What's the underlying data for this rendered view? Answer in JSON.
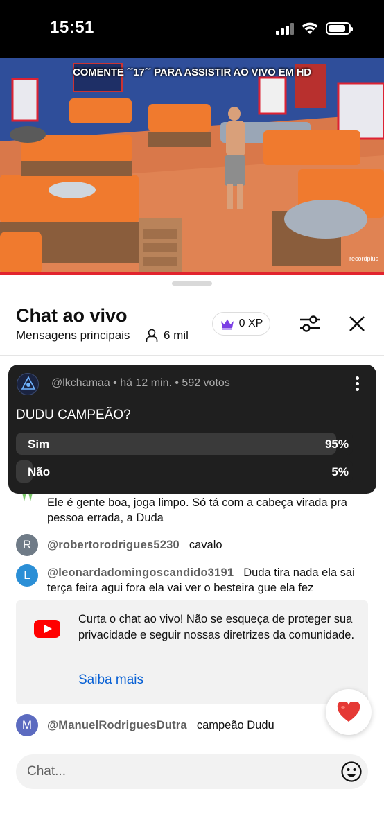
{
  "status_bar": {
    "time": "15:51"
  },
  "video": {
    "banner_text": "COMENTE ´´17´´ PARA ASSISTIR AO VIVO EM HD",
    "watermark": "recordplus",
    "progress": 1.0
  },
  "chat_header": {
    "title": "Chat ao vivo",
    "mode": "Mensagens principais",
    "viewers": "6 mil",
    "xp": "0 XP"
  },
  "poll": {
    "author": "@lkchamaa",
    "time": "há 12 min.",
    "votes": "592 votos",
    "meta": "@lkchamaa • há 12 min. • 592 votos",
    "question": "DUDU CAMPEÃO?",
    "options": [
      {
        "label": "Sim",
        "percent_text": "95%",
        "percent": 95
      },
      {
        "label": "Não",
        "percent_text": "5%",
        "percent": 5
      }
    ]
  },
  "messages": [
    {
      "author": "",
      "avatar_letter": "",
      "text": "Ele é gente boa, joga limpo. Só tá com a cabeça virada pra pessoa errada, a Duda",
      "avatar_color": "#7cc86a"
    },
    {
      "author": "@robertorodrigues5230",
      "avatar_letter": "R",
      "text": "cavalo",
      "avatar_color": "#6f7b87"
    },
    {
      "author": "@leonardadomingoscandido3191",
      "avatar_letter": "L",
      "text": "Duda tira nada ela sai terça feira agui fora ela vai ver o besteira gue ela fez",
      "avatar_color": "#2b8fd6"
    },
    {
      "author": "@ManuelRodriguesDutra",
      "avatar_letter": "M",
      "text": "campeão Dudu",
      "avatar_color": "#5c6bc0"
    }
  ],
  "info_card": {
    "text": "Curta o chat ao vivo! Não se esqueça de proteger sua privacidade e seguir nossas diretrizes da comunidade.",
    "link": "Saiba mais"
  },
  "chat_input": {
    "placeholder": "Chat..."
  },
  "colors": {
    "accent_red": "#ff0000",
    "link_blue": "#065fd4",
    "poll_bg": "#1f1f1f",
    "xp_crown": "#7b3fe4"
  },
  "icons": [
    "signal-icon",
    "wifi-icon",
    "battery-icon",
    "crown-icon",
    "person-icon",
    "filter-icon",
    "close-icon",
    "kebab-icon",
    "youtube-icon",
    "heart-icon",
    "emoji-icon"
  ]
}
